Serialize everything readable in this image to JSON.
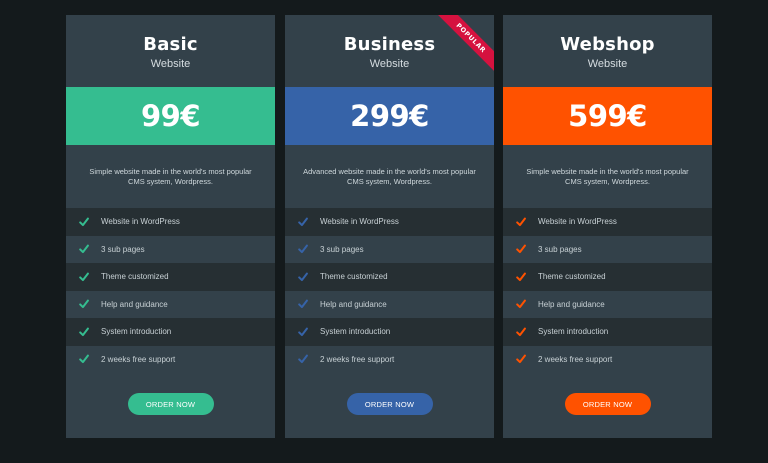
{
  "colors": {
    "background": "#141a1c",
    "card": "#33414a",
    "row_dark": "#262f33",
    "basic_accent": "#35bd90",
    "business_accent": "#3663a8",
    "webshop_accent": "#ff5200",
    "ribbon": "#d5123f"
  },
  "plans": [
    {
      "name": "Basic",
      "subtitle": "Website",
      "price": "99€",
      "accent": "#35bd90",
      "description": "Simple website made in the world's most popular CMS system, Wordpress.",
      "features": [
        "Website in WordPress",
        "3 sub pages",
        "Theme customized",
        "Help and guidance",
        "System introduction",
        "2 weeks free support"
      ],
      "cta": "ORDER NOW"
    },
    {
      "name": "Business",
      "subtitle": "Website",
      "price": "299€",
      "accent": "#3663a8",
      "badge": "POPULAR",
      "description": "Advanced website made in the world's most popular CMS system, Wordpress.",
      "features": [
        "Website in WordPress",
        "3 sub pages",
        "Theme customized",
        "Help and guidance",
        "System introduction",
        "2 weeks free support"
      ],
      "cta": "ORDER NOW"
    },
    {
      "name": "Webshop",
      "subtitle": "Website",
      "price": "599€",
      "accent": "#ff5200",
      "description": "Simple website made in the world's most popular CMS system, Wordpress.",
      "features": [
        "Website in WordPress",
        "3 sub pages",
        "Theme customized",
        "Help and guidance",
        "System introduction",
        "2 weeks free support"
      ],
      "cta": "ORDER NOW"
    }
  ],
  "icons": {
    "feature_check": "checkmark-icon"
  }
}
